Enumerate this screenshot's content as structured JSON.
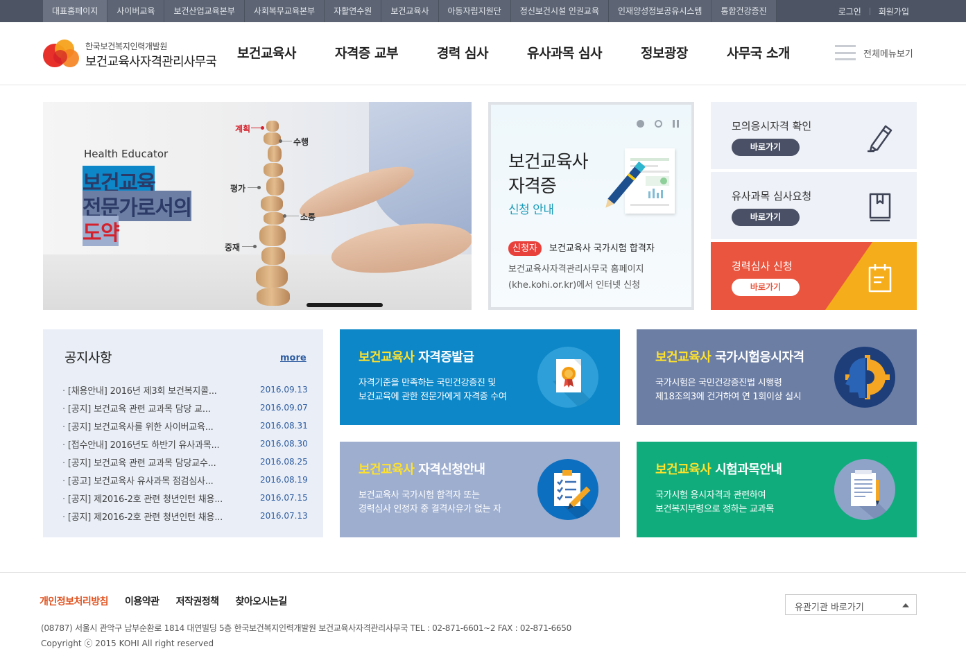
{
  "topbar": {
    "links": [
      "대표홈페이지",
      "사이버교육",
      "보건산업교육본부",
      "사회복무교육본부",
      "자활연수원",
      "보건교육사",
      "아동자립지원단",
      "정신보건시설 인권교육",
      "인재양성정보공유시스템",
      "통합건강증진"
    ],
    "login": "로그인",
    "join": "회원가입"
  },
  "header": {
    "org": "한국보건복지인력개발원",
    "name": "보건교육사자격관리사무국",
    "nav": [
      "보건교육사",
      "자격증 교부",
      "경력 심사",
      "유사과목 심사",
      "정보광장",
      "사무국 소개"
    ],
    "all_menu": "전체메뉴보기"
  },
  "hero": {
    "subtitle": "Health Educator",
    "line1": "보건교육",
    "line2": "전문가로서의",
    "line3": "도약",
    "labels": [
      "계획",
      "수행",
      "평가",
      "소통",
      "중재"
    ]
  },
  "promo": {
    "title1": "보건교육사",
    "title2": "자격증",
    "title3": "신청 안내",
    "badge": "신청자",
    "who": "보건교육사 국가시험 합격자",
    "desc1": "보건교육사자격관리사무국 홈페이지",
    "desc2": "(khe.kohi.or.kr)에서 인터넷 신청"
  },
  "quick": [
    {
      "title": "모의응시자격 확인",
      "button": "바로가기",
      "icon": "pencil-icon"
    },
    {
      "title": "유사과목 심사요청",
      "button": "바로가기",
      "icon": "book-icon"
    },
    {
      "title": "경력심사 신청",
      "button": "바로가기",
      "icon": "clipboard-icon"
    }
  ],
  "notice": {
    "title": "공지사항",
    "more": "more",
    "items": [
      {
        "title": "[채용안내] 2016년 제3회 보건복지콜...",
        "date": "2016.09.13"
      },
      {
        "title": "[공지] 보건교육 관련 교과목 담당 교...",
        "date": "2016.09.07"
      },
      {
        "title": "[공지] 보건교육사를 위한 사이버교육...",
        "date": "2016.08.31"
      },
      {
        "title": "[접수안내] 2016년도 하반기 유사과목...",
        "date": "2016.08.30"
      },
      {
        "title": "[공지] 보건교육 관련 교과목 담당교수...",
        "date": "2016.08.25"
      },
      {
        "title": "[공고] 보건교육사 유사과목 점검심사...",
        "date": "2016.08.19"
      },
      {
        "title": "[공지] 제2016-2호 관련 청년인턴 채용...",
        "date": "2016.07.15"
      },
      {
        "title": "[공지] 제2016-2호 관련 청년인턴 채용...",
        "date": "2016.07.13"
      }
    ]
  },
  "tiles": [
    {
      "prefix": "보건교육사",
      "title": " 자격증발급",
      "desc1": "자격기준을 만족하는 국민건강증진 및",
      "desc2": "보건교육에 관한 전문가에게 자격증 수여",
      "icon": "certificate-icon"
    },
    {
      "prefix": "보건교육사",
      "title": " 국가시험응시자격",
      "desc1": "국가시험은 국민건강증진법 시행령",
      "desc2": "제18조의3에 건거하여 연 1회이상 실시",
      "icon": "head-gear-icon"
    },
    {
      "prefix": "보건교육사",
      "title": " 자격신청안내",
      "desc1": "보건교육사 국가시험 합격자 또는",
      "desc2": "경력심사 인정자 중 결격사유가 없는 자",
      "icon": "checklist-icon"
    },
    {
      "prefix": "보건교육사",
      "title": " 시험과목안내",
      "desc1": "국가시험 응시자격과 관련하여",
      "desc2": "보건복지부령으로 정하는 교과목",
      "icon": "document-icon"
    }
  ],
  "footer": {
    "links": [
      "개인정보처리방침",
      "이용약관",
      "저작권정책",
      "찾아오시는길"
    ],
    "select": "유관기관 바로가기",
    "address": "(08787) 서울시 관악구 남부순환로 1814 대연빌딩 5층 한국보건복지인력개발원 보건교육사자격관리사무국 TEL : 02-871-6601~2 FAX : 02-871-6650",
    "copyright": "Copyright ⓒ 2015 KOHI All right reserved"
  },
  "colors": {
    "topbar": "#4d5564",
    "navy": "#2b3a66",
    "red": "#d5212b",
    "tile_blue": "#0d87c8",
    "tile_slate": "#6c7ea4",
    "tile_lavender": "#9eaecf",
    "tile_green": "#10ac7c",
    "tile_yellow": "#ffe22b"
  }
}
